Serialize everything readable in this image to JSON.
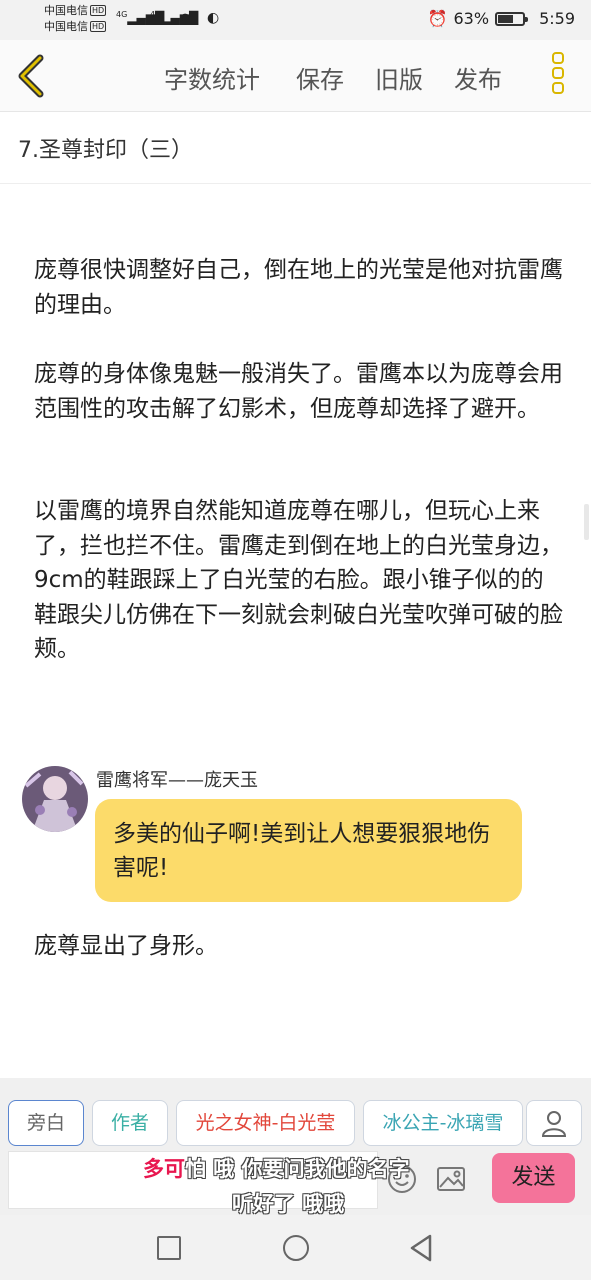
{
  "status_bar": {
    "carrier1": "中国电信",
    "carrier2": "中国电信",
    "hd_badge": "HD",
    "signal1": "4G",
    "signal2": "4G",
    "battery": "63%",
    "battery_level": 0.63,
    "time": "5:59",
    "icons": [
      "wifi-icon",
      "alarm-icon",
      "battery-icon"
    ]
  },
  "toolbar": {
    "word_count": "字数统计",
    "save": "保存",
    "old_version": "旧版",
    "publish": "发布"
  },
  "chapter_title": "7.圣尊封印（三）",
  "paragraphs": [
    "庞尊很快调整好自己，倒在地上的光莹是他对抗雷鹰的理由。",
    "庞尊的身体像鬼魅一般消失了。雷鹰本以为庞尊会用范围性的攻击解了幻影术，但庞尊却选择了避开。",
    "以雷鹰的境界自然能知道庞尊在哪儿，但玩心上来了，拦也拦不住。雷鹰走到倒在地上的白光莹身边，9cm的鞋跟踩上了白光莹的右脸。跟小锥子似的的鞋跟尖儿仿佛在下一刻就会刺破白光莹吹弹可破的脸颊。"
  ],
  "dialogue": {
    "speaker": "雷鹰将军——庞天玉",
    "bubble": "多美的仙子啊!美到让人想要狠狠地伤害呢!"
  },
  "after_dialogue": "庞尊显出了身形。",
  "composer": {
    "chips": [
      "旁白",
      "作者",
      "光之女神-白光莹",
      "冰公主-冰璃雪"
    ],
    "send": "发送",
    "danmu_line1_pink": "多可",
    "danmu_line1": "怕 哦 你要问我他的名字",
    "danmu_line2": "听好了 哦哦"
  },
  "colors": {
    "accent_yellow": "#d9b600",
    "bubble": "#fcdb6a",
    "send_button": "#f4739a",
    "chip_author": "#3bb0a5",
    "chip_red": "#e2473b",
    "chip_teal": "#3aa5b3"
  }
}
